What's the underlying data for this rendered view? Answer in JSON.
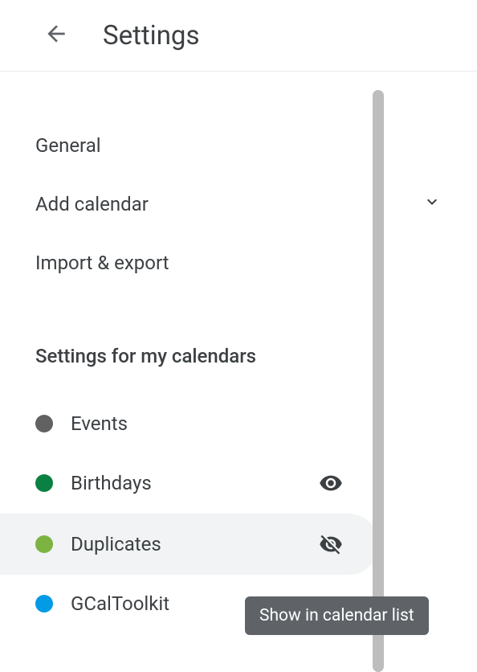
{
  "header": {
    "title": "Settings"
  },
  "nav": {
    "general": "General",
    "add_calendar": "Add calendar",
    "import_export": "Import & export"
  },
  "section": {
    "title": "Settings for my calendars"
  },
  "calendars": [
    {
      "label": "Events",
      "color": "#616161"
    },
    {
      "label": "Birthdays",
      "color": "#0b8043"
    },
    {
      "label": "Duplicates",
      "color": "#7cb342"
    },
    {
      "label": "GCalToolkit",
      "color": "#039be5"
    }
  ],
  "tooltip": {
    "text": "Show in calendar list"
  }
}
